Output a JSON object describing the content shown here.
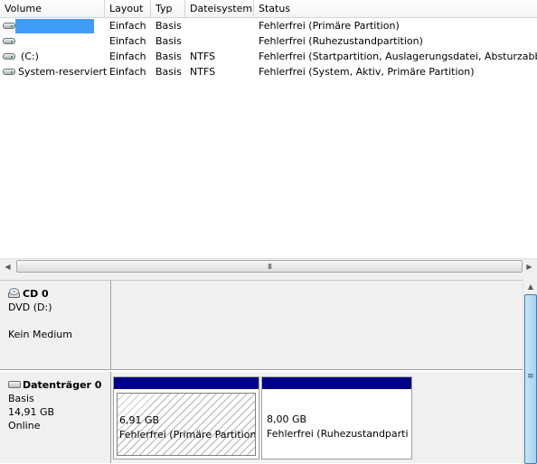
{
  "columns": [
    "Volume",
    "Layout",
    "Typ",
    "Dateisystem",
    "Status"
  ],
  "volumes": [
    {
      "name": "",
      "layout": "Einfach",
      "type": "Basis",
      "fs": "",
      "status": "Fehlerfrei (Primäre Partition)"
    },
    {
      "name": "",
      "layout": "Einfach",
      "type": "Basis",
      "fs": "",
      "status": "Fehlerfrei (Ruhezustandpartition)"
    },
    {
      "name": "(C:)",
      "layout": "Einfach",
      "type": "Basis",
      "fs": "NTFS",
      "status": "Fehlerfrei (Startpartition, Auslagerungsdatei, Absturzabbild"
    },
    {
      "name": "System-reserviert",
      "layout": "Einfach",
      "type": "Basis",
      "fs": "NTFS",
      "status": "Fehlerfrei (System, Aktiv, Primäre Partition)"
    }
  ],
  "hscroll": {
    "grip": "III",
    "left_arrow": "◀",
    "right_arrow": "▶"
  },
  "vscroll": {
    "grip": "≡",
    "up_arrow": "▲"
  },
  "disks": {
    "cd": {
      "title": "CD 0",
      "line1": "DVD (D:)",
      "line2": "Kein Medium"
    },
    "disk0": {
      "title": "Datenträger 0",
      "line1": "Basis",
      "line2": "14,91 GB",
      "line3": "Online",
      "partitions": [
        {
          "size": "6,91 GB",
          "status": "Fehlerfrei (Primäre Partition)"
        },
        {
          "size": "8,00 GB",
          "status": "Fehlerfrei (Ruhezustandpartit"
        }
      ]
    }
  },
  "colors": {
    "partition_bar": "#00008b",
    "redacted": "#3f9dfa",
    "panel": "#f0f0f0"
  }
}
